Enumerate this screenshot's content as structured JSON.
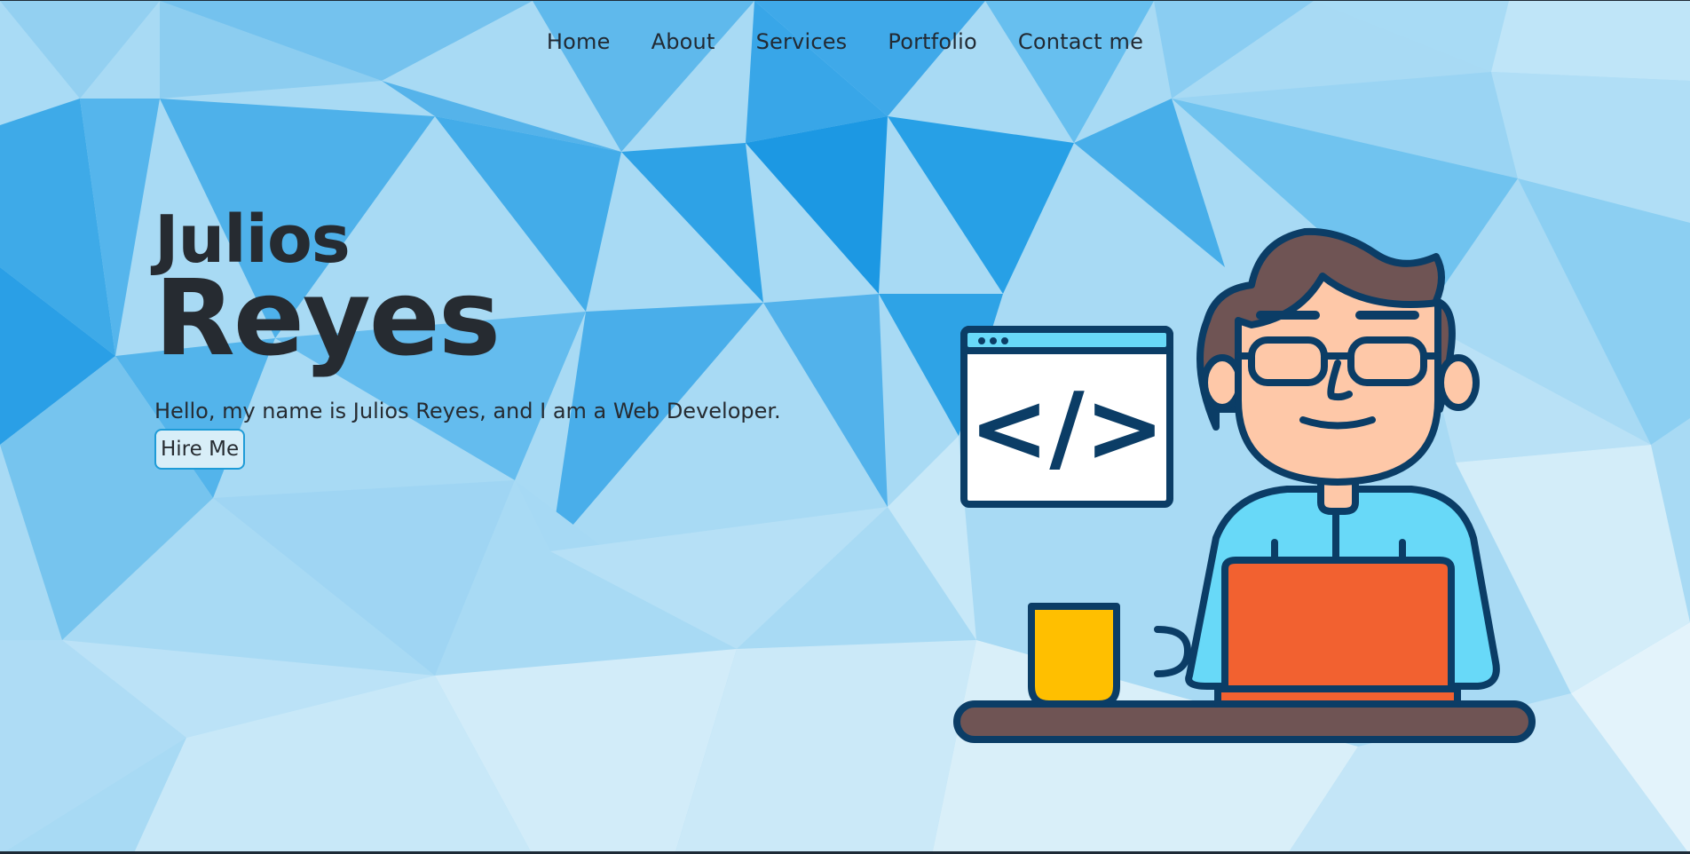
{
  "nav": {
    "items": [
      {
        "label": "Home"
      },
      {
        "label": "About"
      },
      {
        "label": "Services"
      },
      {
        "label": "Portfolio"
      },
      {
        "label": "Contact me"
      }
    ]
  },
  "hero": {
    "first_name": "Julios",
    "last_name": "Reyes",
    "intro": "Hello, my name is Julios Reyes, and I am a Web Developer.",
    "cta_label": "Hire Me"
  },
  "illustration": {
    "code_symbol": "</>",
    "icon": "developer-at-laptop-illustration"
  },
  "colors": {
    "background": "#9fd4f2",
    "text": "#262b31",
    "accent": "#1e9bd7",
    "laptop": "#f26130",
    "mug": "#ffbf00",
    "shirt": "#68d9f8",
    "hair": "#6f5454",
    "outline": "#0b3d66"
  }
}
